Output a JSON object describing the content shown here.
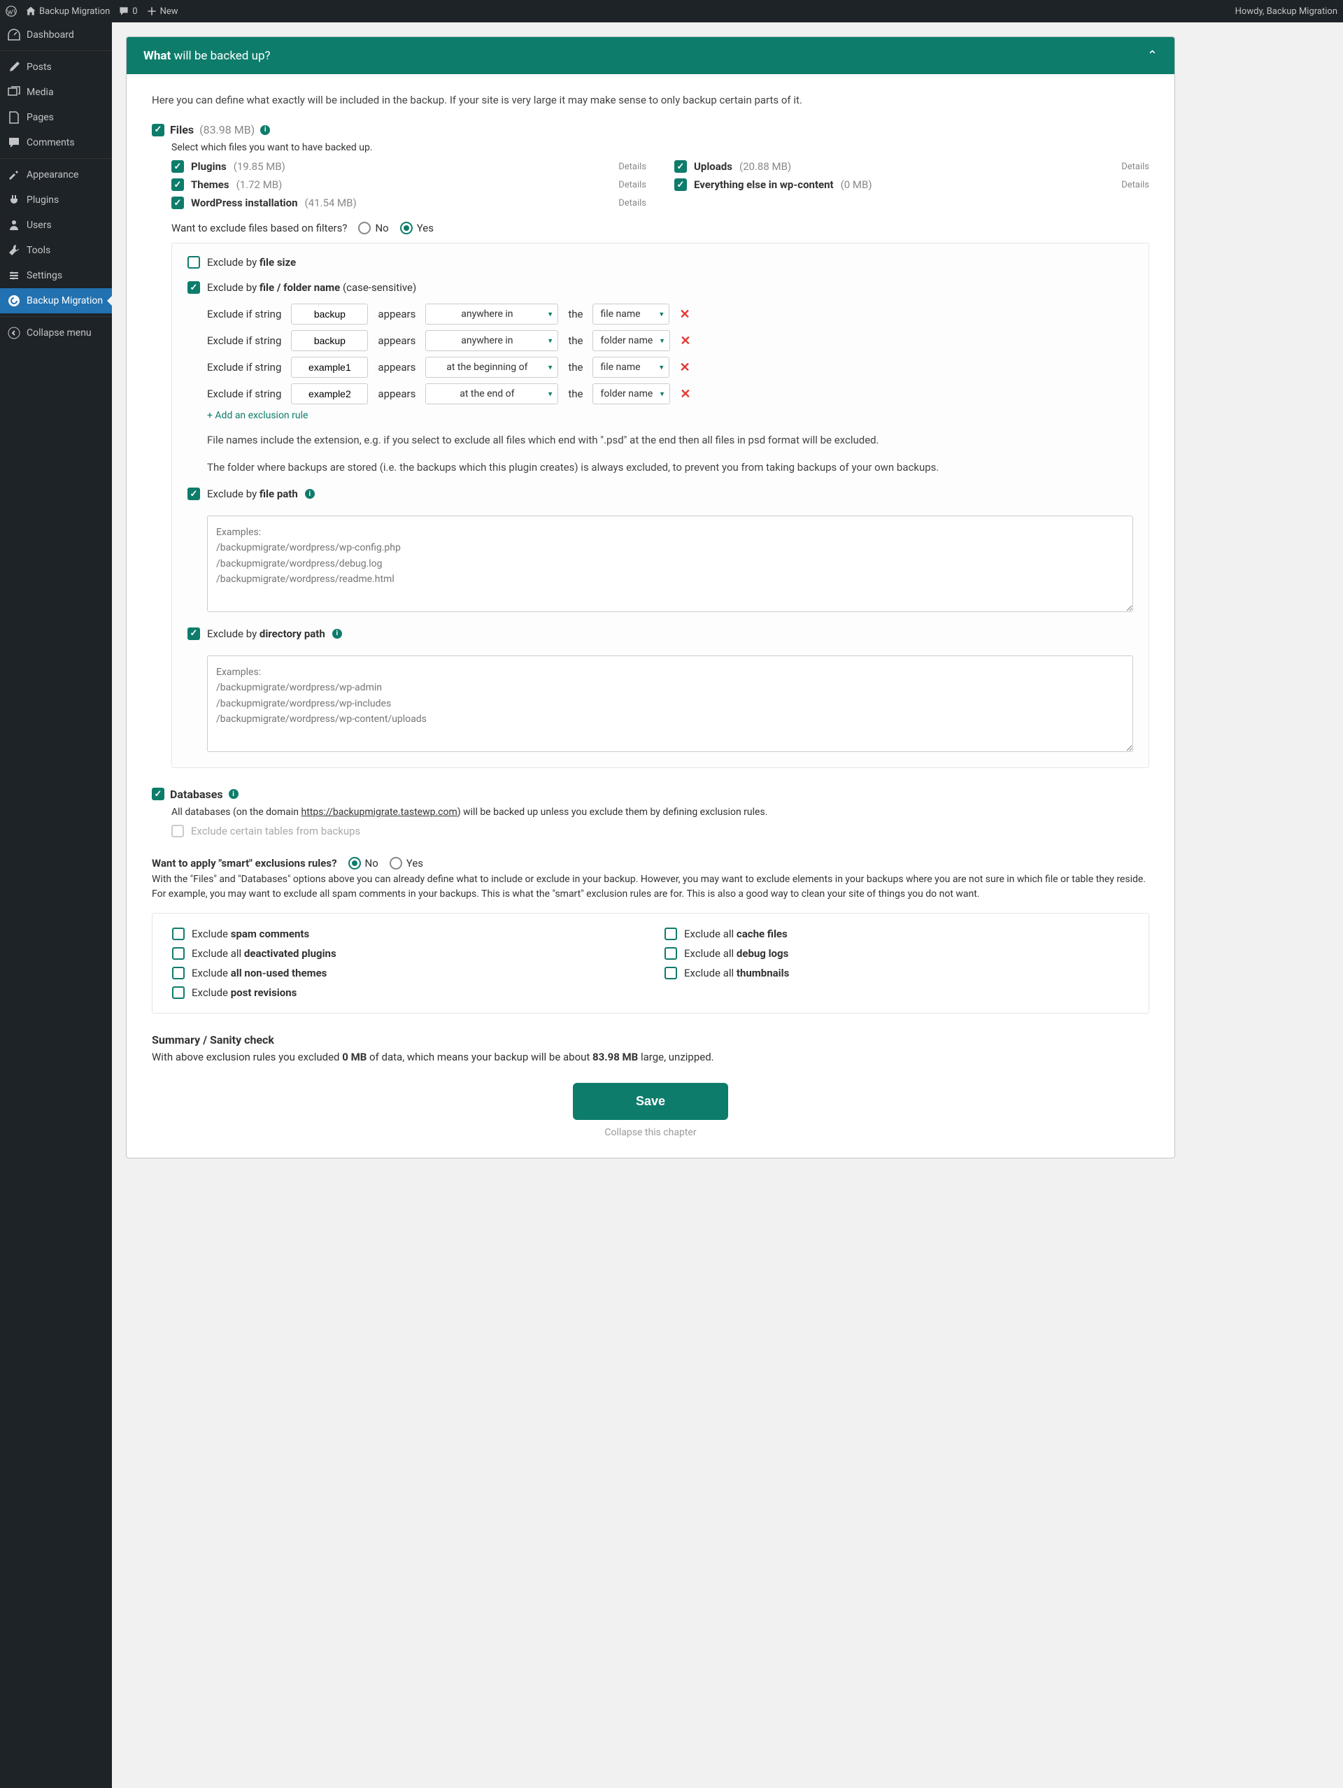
{
  "adminBar": {
    "siteName": "Backup Migration",
    "comments": "0",
    "new": "New",
    "howdy": "Howdy, Backup Migration"
  },
  "sidebar": {
    "dashboard": "Dashboard",
    "posts": "Posts",
    "media": "Media",
    "pages": "Pages",
    "comments": "Comments",
    "appearance": "Appearance",
    "plugins": "Plugins",
    "users": "Users",
    "tools": "Tools",
    "settings": "Settings",
    "backupMigration": "Backup Migration",
    "collapse": "Collapse menu"
  },
  "panel": {
    "titleBold": "What",
    "titleRest": " will be backed up?",
    "intro": "Here you can define what exactly will be included in the backup. If your site is very large it may make sense to only backup certain parts of it."
  },
  "files": {
    "label": "Files",
    "size": "(83.98 MB)",
    "selectHelper": "Select which files you want to have backed up.",
    "plugins": {
      "label": "Plugins",
      "size": "(19.85 MB)"
    },
    "uploads": {
      "label": "Uploads",
      "size": "(20.88 MB)"
    },
    "themes": {
      "label": "Themes",
      "size": "(1.72 MB)"
    },
    "everything": {
      "label": "Everything else in wp-content",
      "size": "(0 MB)"
    },
    "wpinstall": {
      "label": "WordPress installation",
      "size": "(41.54 MB)"
    },
    "detailsLabel": "Details"
  },
  "filters": {
    "question": "Want to exclude files based on filters?",
    "no": "No",
    "yes": "Yes",
    "bySizePrefix": "Exclude by ",
    "bySizeBold": "file size",
    "byNamePrefix": "Exclude by ",
    "byNameBold": "file / folder name",
    "byNameSuffix": " (case-sensitive)",
    "ruleLabel": "Exclude if string",
    "appears": "appears",
    "the": "the",
    "rules": [
      {
        "value": "backup",
        "position": "anywhere in",
        "target": "file name"
      },
      {
        "value": "backup",
        "position": "anywhere in",
        "target": "folder name"
      },
      {
        "value": "example1",
        "position": "at the beginning of",
        "target": "file name"
      },
      {
        "value": "example2",
        "position": "at the end of",
        "target": "folder name"
      }
    ],
    "addRule": "+ Add an exclusion rule",
    "note1": "File names include the extension, e.g. if you select to exclude all files which end with \".psd\" at the end then all files in psd format will be excluded.",
    "note2": "The folder where backups are stored (i.e. the backups which this plugin creates) is always excluded, to prevent you from taking backups of your own backups.",
    "byFilePathPrefix": "Exclude by ",
    "byFilePathBold": "file path",
    "filePathPlaceholder": "Examples:\n/backupmigrate/wordpress/wp-config.php\n/backupmigrate/wordpress/debug.log\n/backupmigrate/wordpress/readme.html",
    "byDirPathPrefix": "Exclude by ",
    "byDirPathBold": "directory path",
    "dirPathPlaceholder": "Examples:\n/backupmigrate/wordpress/wp-admin\n/backupmigrate/wordpress/wp-includes\n/backupmigrate/wordpress/wp-content/uploads"
  },
  "databases": {
    "label": "Databases",
    "textPrefix": "All databases (on the domain ",
    "domain": "https://backupmigrate.tastewp.com",
    "textSuffix": ") will be backed up unless you exclude them by defining exclusion rules.",
    "excludeTables": "Exclude certain tables from backups"
  },
  "smart": {
    "question": "Want to apply \"smart\" exclusions rules?",
    "no": "No",
    "yes": "Yes",
    "explain": "With the \"Files\" and \"Databases\" options above you can already define what to include or exclude in your backup. However, you may want to exclude elements in your backups where you are not sure in which file or table they reside. For example, you may want to exclude all spam comments in your backups. This is what the \"smart\" exclusion rules are for. This is also a good way to clean your site of things you do not want.",
    "opts": {
      "spamPrefix": "Exclude ",
      "spamBold": "spam comments",
      "cachePrefix": "Exclude all ",
      "cacheBold": "cache files",
      "deactPrefix": "Exclude all ",
      "deactBold": "deactivated plugins",
      "debugPrefix": "Exclude all ",
      "debugBold": "debug logs",
      "themesPrefix": "Exclude ",
      "themesBold": "all non-used themes",
      "thumbPrefix": "Exclude all ",
      "thumbBold": "thumbnails",
      "revPrefix": "Exclude ",
      "revBold": "post revisions"
    }
  },
  "summary": {
    "title": "Summary / Sanity check",
    "textPrefix": "With above exclusion rules you excluded ",
    "excluded": "0 MB",
    "textMid": " of data, which means your backup will be about ",
    "backup": "83.98 MB",
    "textSuffix": " large, unzipped."
  },
  "save": "Save",
  "collapse": "Collapse this chapter"
}
